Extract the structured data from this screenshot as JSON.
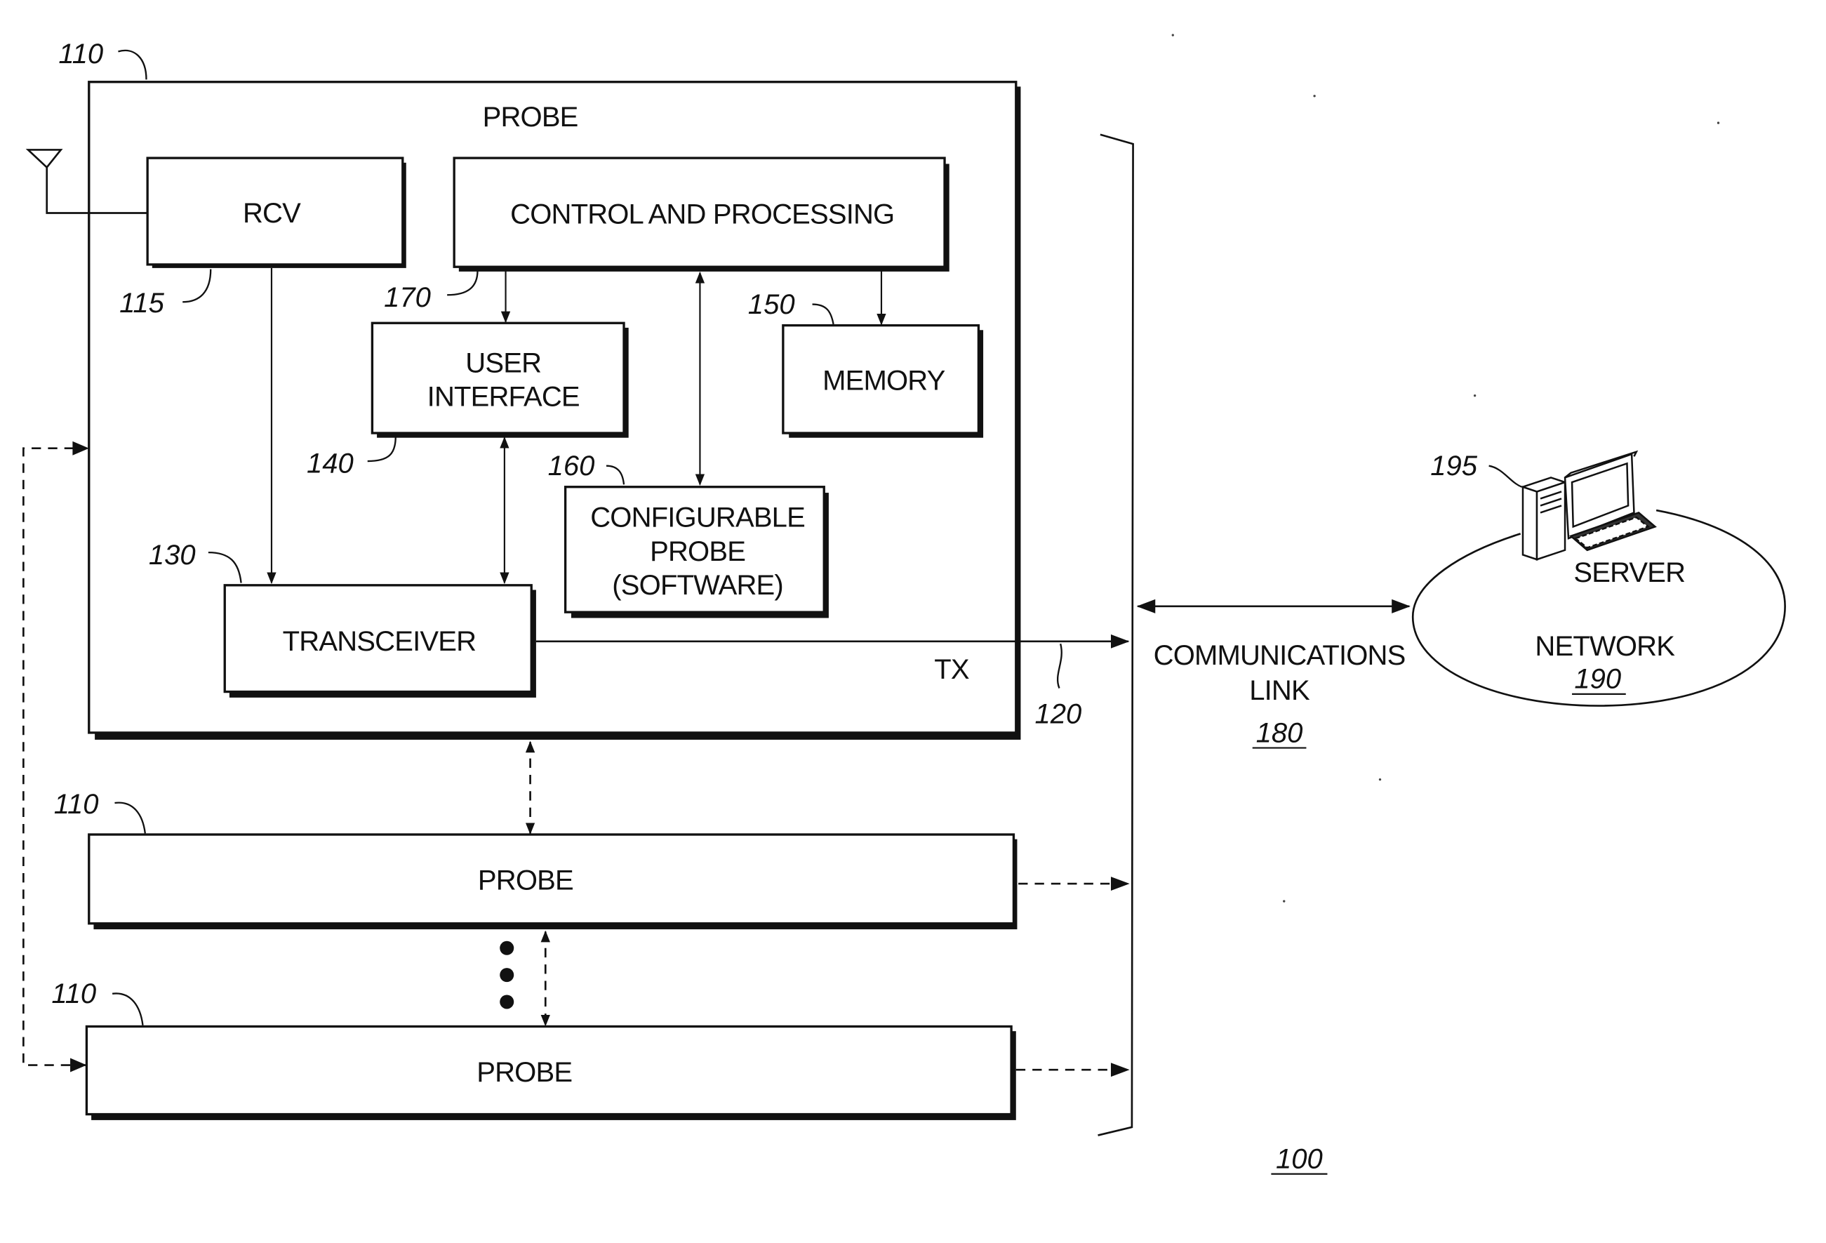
{
  "figure": {
    "number": "100",
    "main_probe": {
      "ref": "110",
      "title": "PROBE",
      "blocks": {
        "rcv": {
          "label": "RCV",
          "ref": "115"
        },
        "control": {
          "label": "CONTROL AND PROCESSING",
          "ref": "170"
        },
        "user_interface": {
          "label_line1": "USER",
          "label_line2": "INTERFACE",
          "ref": "140"
        },
        "memory": {
          "label": "MEMORY",
          "ref": "150"
        },
        "configurable_probe": {
          "label_line1": "CONFIGURABLE",
          "label_line2": "PROBE",
          "label_line3": "(SOFTWARE)",
          "ref": "160"
        },
        "transceiver": {
          "label": "TRANSCEIVER",
          "ref": "130"
        }
      },
      "tx_label": "TX",
      "tx_ref": "120"
    },
    "probe_2": {
      "label": "PROBE",
      "ref": "110"
    },
    "probe_3": {
      "label": "PROBE",
      "ref": "110"
    },
    "communications_link": {
      "label_line1": "COMMUNICATIONS",
      "label_line2": "LINK",
      "ref": "180"
    },
    "network": {
      "label": "NETWORK",
      "ref": "190"
    },
    "server": {
      "label": "SERVER",
      "ref": "195"
    }
  }
}
